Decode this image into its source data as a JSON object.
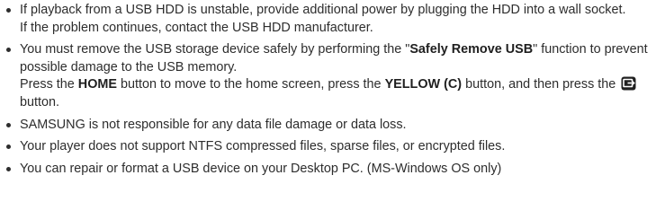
{
  "notes": [
    {
      "paragraphs": [
        "If playback from a USB HDD is unstable, provide additional power by plugging the HDD into a wall socket.",
        "If the problem continues, contact the USB HDD manufacturer."
      ]
    },
    {
      "p1_a": "You must remove the USB storage device safely by performing the \"",
      "p1_bold": "Safely Remove USB",
      "p1_b": "\" function to prevent possible damage to the USB memory.",
      "p2_a": "Press the ",
      "p2_bold1": "HOME",
      "p2_b": " button to move to the home screen, press the ",
      "p2_bold2": "YELLOW (C)",
      "p2_c": " button, and then press the ",
      "p2_icon": "exit-to-source-icon",
      "p2_d": " button."
    },
    {
      "text": "SAMSUNG is not responsible for any data file damage or data loss."
    },
    {
      "text": "Your player does not support NTFS compressed files, sparse files, or encrypted files."
    },
    {
      "text": "You can repair or format a USB device on your Desktop PC. (MS-Windows OS only)"
    }
  ],
  "colors": {
    "text": "#2d2d2d",
    "icon": "#1f1f1f"
  }
}
